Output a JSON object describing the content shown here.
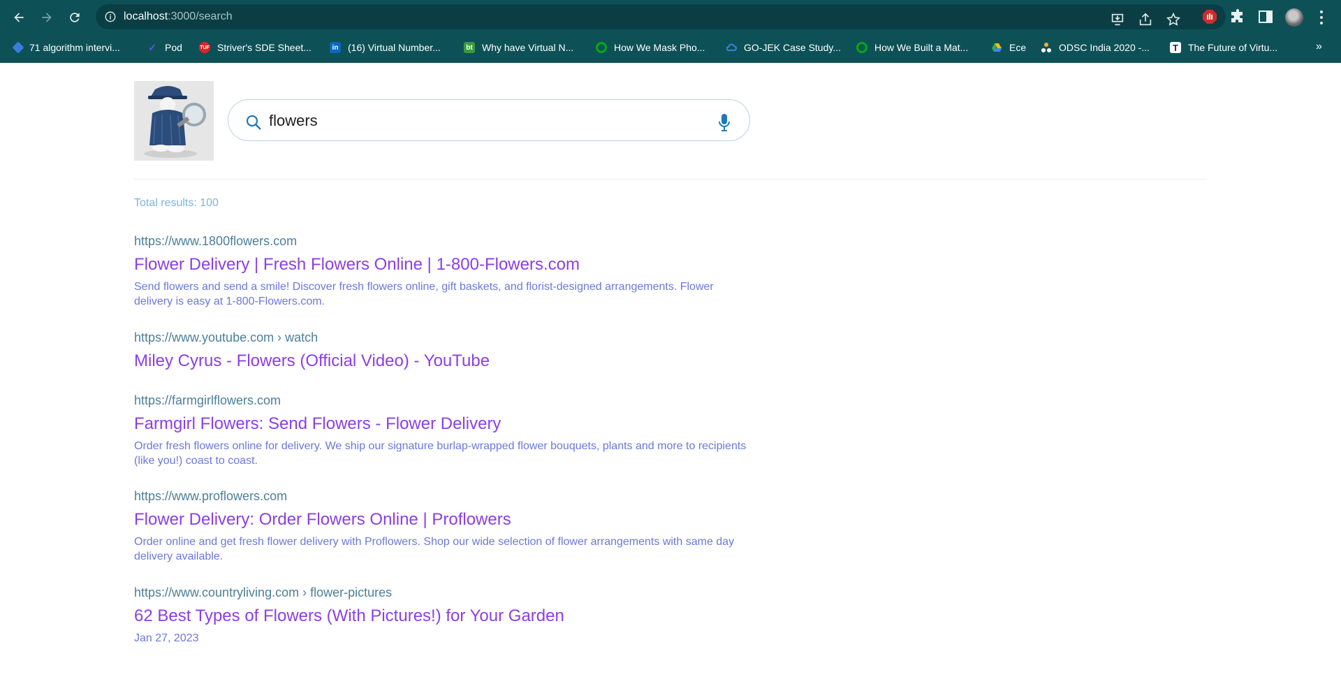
{
  "browser": {
    "url_host": "localhost",
    "url_path": ":3000/search",
    "bookmarks": [
      {
        "label": "71 algorithm intervi...",
        "icon": "diamond-icon",
        "color": "#3b7be0"
      },
      {
        "label": "Pod",
        "icon": "pod-icon",
        "color": "#5a3fd6"
      },
      {
        "label": "Striver's SDE Sheet...",
        "icon": "tuf-icon",
        "color": "#e02424"
      },
      {
        "label": "(16) Virtual Number...",
        "icon": "linkedin-icon",
        "color": "#0a66c2"
      },
      {
        "label": "Why have Virtual N...",
        "icon": "bt-icon",
        "color": "#3b9b3b"
      },
      {
        "label": "How We Mask Pho...",
        "icon": "gojek-icon",
        "color": "#00aa13"
      },
      {
        "label": "GO-JEK Case Study...",
        "icon": "cloud-icon",
        "color": "#4285f4"
      },
      {
        "label": "How We Built a Mat...",
        "icon": "gojek-icon",
        "color": "#00aa13"
      },
      {
        "label": "Ece",
        "icon": "drive-icon",
        "color": "#fbbc04"
      },
      {
        "label": "ODSC India 2020 -...",
        "icon": "odsc-icon",
        "color": "#f2b233"
      },
      {
        "label": "The Future of Virtu...",
        "icon": "t-icon",
        "color": "#ffffff"
      }
    ]
  },
  "search": {
    "query": "flowers",
    "total_label": "Total results: 100"
  },
  "results": [
    {
      "url": "https://www.1800flowers.com",
      "title": "Flower Delivery | Fresh Flowers Online | 1-800-Flowers.com",
      "desc": "Send flowers and send a smile! Discover fresh flowers online, gift baskets, and florist-designed arrangements. Flower delivery is easy at 1-800-Flowers.com."
    },
    {
      "url": "https://www.youtube.com › watch",
      "title": "Miley Cyrus - Flowers (Official Video) - YouTube",
      "desc": ""
    },
    {
      "url": "https://farmgirlflowers.com",
      "title": "Farmgirl Flowers: Send Flowers - Flower Delivery",
      "desc": "Order fresh flowers online for delivery. We ship our signature burlap-wrapped flower bouquets, plants and more to recipients (like you!) coast to coast."
    },
    {
      "url": "https://www.proflowers.com",
      "title": "Flower Delivery: Order Flowers Online | Proflowers",
      "desc": "Order online and get fresh flower delivery with Proflowers. Shop our wide selection of flower arrangements with same day delivery available."
    },
    {
      "url": "https://www.countryliving.com › flower-pictures",
      "title": "62 Best Types of Flowers (With Pictures!) for Your Garden",
      "date": "Jan 27, 2023"
    }
  ]
}
